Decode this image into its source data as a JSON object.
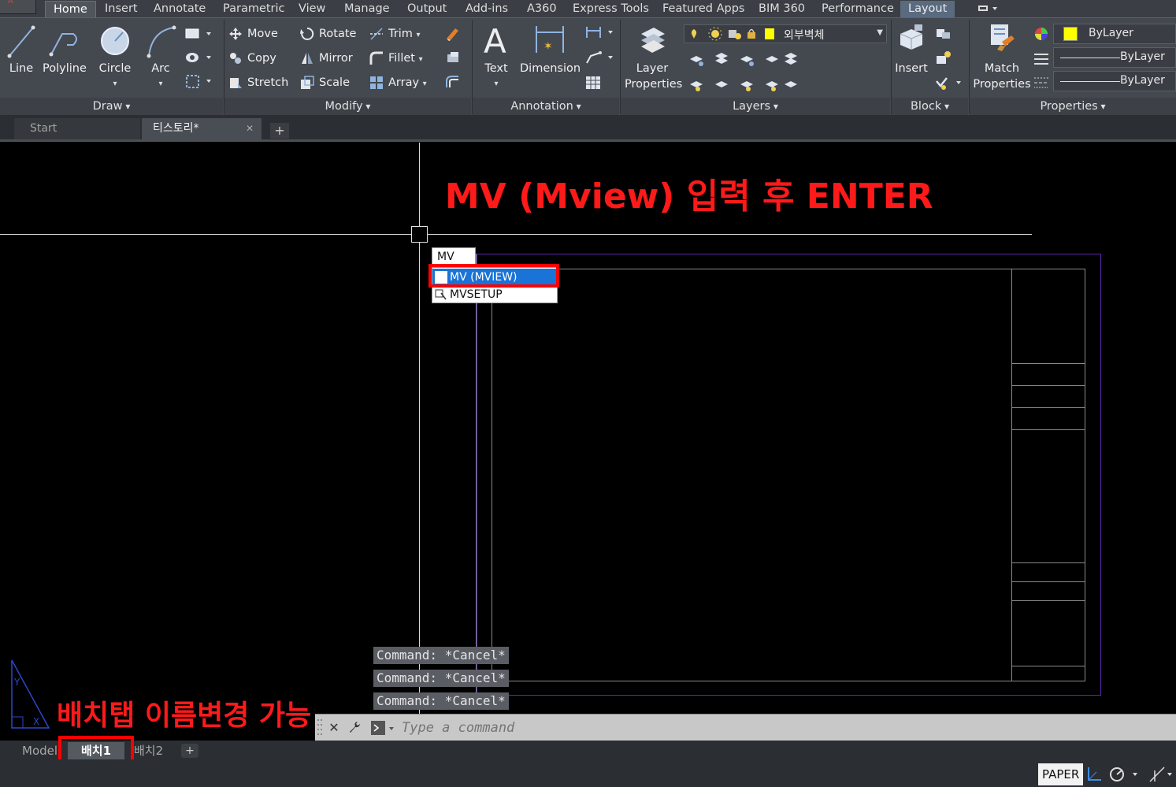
{
  "ribbon": {
    "tabs": [
      "Home",
      "Insert",
      "Annotate",
      "Parametric",
      "View",
      "Manage",
      "Output",
      "Add-ins",
      "A360",
      "Express Tools",
      "Featured Apps",
      "BIM 360",
      "Performance",
      "Layout"
    ],
    "active_tab": "Home",
    "draw": {
      "title": "Draw",
      "line": "Line",
      "polyline": "Polyline",
      "circle": "Circle",
      "arc": "Arc"
    },
    "modify": {
      "title": "Modify",
      "move": "Move",
      "rotate": "Rotate",
      "trim": "Trim",
      "copy": "Copy",
      "mirror": "Mirror",
      "fillet": "Fillet",
      "stretch": "Stretch",
      "scale": "Scale",
      "array": "Array"
    },
    "annotation": {
      "title": "Annotation",
      "text": "Text",
      "dimension": "Dimension"
    },
    "layers": {
      "title": "Layers",
      "layer_properties": "Layer Properties",
      "current_layer": "외부벽체",
      "layer_color": "#ffff00"
    },
    "block": {
      "title": "Block",
      "insert": "Insert"
    },
    "properties": {
      "title": "Properties",
      "match_properties": "Match Properties",
      "color": "ByLayer",
      "linetype": "ByLayer",
      "lineweight": "ByLayer",
      "color_swatch": "#ffff00"
    }
  },
  "doc_tabs": {
    "start": "Start",
    "file": "티스토리*"
  },
  "canvas": {
    "instruction": "MV (Mview) 입력 후 ENTER",
    "rename_note": "배치탭 이름변경 가능",
    "annot_color": "#ff1a1a",
    "viewport_color": "#5b2ab0",
    "autocomplete": {
      "typed": "MV",
      "items": [
        "MV (MVIEW)",
        "MVSETUP"
      ]
    },
    "history": [
      "Command: *Cancel*",
      "Command: *Cancel*",
      "Command: *Cancel*"
    ]
  },
  "command_line": {
    "placeholder": "Type a command"
  },
  "layout_tabs": {
    "model": "Model",
    "layout1": "배치1",
    "layout2": "배치2"
  },
  "status_bar": {
    "space": "PAPER"
  }
}
